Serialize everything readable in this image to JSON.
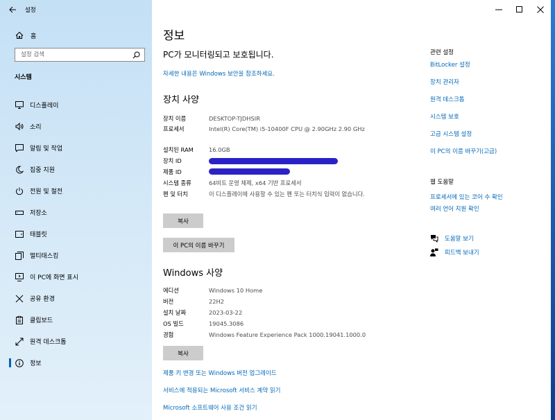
{
  "window": {
    "title": "설정"
  },
  "sidebar": {
    "home_label": "홈",
    "search_placeholder": "설정 검색",
    "section_label": "시스템",
    "items": [
      {
        "label": "디스플레이",
        "icon": "monitor-icon"
      },
      {
        "label": "소리",
        "icon": "speaker-icon"
      },
      {
        "label": "알림 및 작업",
        "icon": "notification-icon"
      },
      {
        "label": "집중 지원",
        "icon": "moon-icon"
      },
      {
        "label": "전원 및 절전",
        "icon": "power-icon"
      },
      {
        "label": "저장소",
        "icon": "storage-icon"
      },
      {
        "label": "태블릿",
        "icon": "tablet-icon"
      },
      {
        "label": "멀티태스킹",
        "icon": "multitask-icon"
      },
      {
        "label": "이 PC에 화면 표시",
        "icon": "project-icon"
      },
      {
        "label": "공유 환경",
        "icon": "share-icon"
      },
      {
        "label": "클립보드",
        "icon": "clipboard-icon"
      },
      {
        "label": "원격 데스크톱",
        "icon": "remote-icon"
      },
      {
        "label": "정보",
        "icon": "info-icon",
        "selected": true
      }
    ]
  },
  "main": {
    "title": "정보",
    "protect_text": "PC가 모니터링되고 보호됩니다.",
    "security_link": "자세한 내용은 Windows 보안을 참조하세요.",
    "device_spec": {
      "heading": "장치 사양",
      "rows": [
        {
          "key": "장치 이름",
          "value": "DESKTOP-TJDHSIR"
        },
        {
          "key": "프로세서",
          "value": "Intel(R) Core(TM) i5-10400F CPU @ 2.90GHz   2.90 GHz"
        },
        {
          "key": "설치된 RAM",
          "value": "16.0GB"
        },
        {
          "key": "장치 ID",
          "value": ""
        },
        {
          "key": "제품 ID",
          "value": ""
        },
        {
          "key": "시스템 종류",
          "value": "64비트 운영 체제, x64 기반 프로세서"
        },
        {
          "key": "펜 및 터치",
          "value": "이 디스플레이에 사용할 수 있는 펜 또는 터치식 입력이 없습니다."
        }
      ],
      "copy_button": "복사",
      "rename_button": "이 PC의 이름 바꾸기"
    },
    "windows_spec": {
      "heading": "Windows 사양",
      "rows": [
        {
          "key": "에디션",
          "value": "Windows 10 Home"
        },
        {
          "key": "버전",
          "value": "22H2"
        },
        {
          "key": "설치 날짜",
          "value": "2023-03-22"
        },
        {
          "key": "OS 빌드",
          "value": "19045.3086"
        },
        {
          "key": "경험",
          "value": "Windows Feature Experience Pack 1000.19041.1000.0"
        }
      ],
      "copy_button": "복사"
    },
    "bottom_links": [
      "제품 키 변경 또는 Windows 버전 업그레이드",
      "서비스에 적용되는 Microsoft 서비스 계약 읽기",
      "Microsoft 소프트웨어 사용 조건 읽기"
    ]
  },
  "related": {
    "heading": "관련 설정",
    "links": [
      "BitLocker 설정",
      "장치 관리자",
      "원격 데스크톱",
      "시스템 보호",
      "고급 시스템 설정",
      "이 PC의 이름 바꾸기(고급)"
    ],
    "help_heading": "웹 도움말",
    "help_links": [
      "프로세서에 있는 코어 수 확인",
      "여러 언어 지원 확인"
    ],
    "get_help": "도움말 보기",
    "feedback": "피드백 보내기"
  },
  "colors": {
    "accent": "#0067b8",
    "redaction": "#2a22c7",
    "button": "#cccccc"
  }
}
